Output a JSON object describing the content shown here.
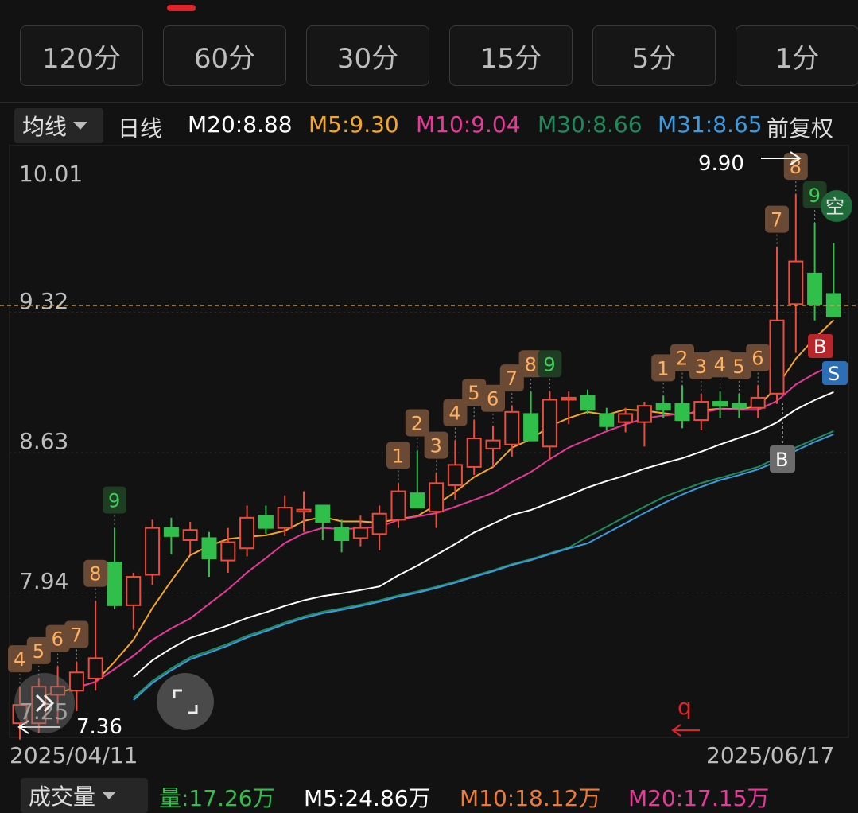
{
  "period_tabs": [
    "120分",
    "60分",
    "30分",
    "15分",
    "5分",
    "1分"
  ],
  "ma_selector": "均线",
  "kline_type": "日线",
  "ma_values": [
    {
      "label": "M20:8.88",
      "color": "#ffffff"
    },
    {
      "label": "M5:9.30",
      "color": "#f5a623"
    },
    {
      "label": "M10:9.04",
      "color": "#e8399a"
    },
    {
      "label": "M30:8.66",
      "color": "#1f8a5b"
    },
    {
      "label": "M31:8.65",
      "color": "#3b9be0"
    }
  ],
  "adjust": "前复权",
  "price_axis": [
    "10.01",
    "9.32",
    "8.63",
    "7.94",
    "7.25"
  ],
  "high_label": "9.90",
  "low_label": "7.36",
  "date_start": "2025/04/11",
  "date_end": "2025/06/17",
  "volume_selector": "成交量",
  "volume_values": [
    {
      "label": "量:17.26万",
      "color": "#2fbf4a"
    },
    {
      "label": "M5:24.86万",
      "color": "#ffffff"
    },
    {
      "label": "M10:18.12万",
      "color": "#f07a30"
    },
    {
      "label": "M20:17.15万",
      "color": "#e8399a"
    }
  ],
  "signal_labels": [
    "B",
    "S",
    "B",
    "空",
    "q"
  ],
  "colors": {
    "up": "#f04a3a",
    "down": "#2fbf4a",
    "grid": "#2a2a2a"
  },
  "chart_data": {
    "type": "candlestick",
    "ylim": [
      7.25,
      10.01
    ],
    "candles": [
      {
        "o": 7.3,
        "h": 7.48,
        "l": 7.22,
        "c": 7.39,
        "n": "4"
      },
      {
        "o": 7.3,
        "h": 7.52,
        "l": 7.25,
        "c": 7.48,
        "n": "5"
      },
      {
        "o": 7.44,
        "h": 7.58,
        "l": 7.3,
        "c": 7.48,
        "n": "6"
      },
      {
        "o": 7.46,
        "h": 7.6,
        "l": 7.36,
        "c": 7.55,
        "n": "7"
      },
      {
        "o": 7.52,
        "h": 7.9,
        "l": 7.46,
        "c": 7.62,
        "n": "8"
      },
      {
        "o": 8.09,
        "h": 8.26,
        "l": 7.86,
        "c": 7.88,
        "n": "9"
      },
      {
        "o": 7.88,
        "h": 8.04,
        "l": 7.76,
        "c": 8.02,
        "n": ""
      },
      {
        "o": 8.03,
        "h": 8.3,
        "l": 7.98,
        "c": 8.26,
        "n": ""
      },
      {
        "o": 8.26,
        "h": 8.31,
        "l": 8.13,
        "c": 8.22,
        "n": ""
      },
      {
        "o": 8.2,
        "h": 8.29,
        "l": 8.13,
        "c": 8.25,
        "n": ""
      },
      {
        "o": 8.21,
        "h": 8.24,
        "l": 8.02,
        "c": 8.11,
        "n": ""
      },
      {
        "o": 8.1,
        "h": 8.26,
        "l": 8.04,
        "c": 8.19,
        "n": ""
      },
      {
        "o": 8.16,
        "h": 8.37,
        "l": 8.12,
        "c": 8.31,
        "n": ""
      },
      {
        "o": 8.32,
        "h": 8.37,
        "l": 8.23,
        "c": 8.26,
        "n": ""
      },
      {
        "o": 8.26,
        "h": 8.42,
        "l": 8.22,
        "c": 8.36,
        "n": ""
      },
      {
        "o": 8.34,
        "h": 8.44,
        "l": 8.24,
        "c": 8.35,
        "n": ""
      },
      {
        "o": 8.37,
        "h": 8.37,
        "l": 8.2,
        "c": 8.29,
        "n": ""
      },
      {
        "o": 8.26,
        "h": 8.3,
        "l": 8.14,
        "c": 8.2,
        "n": ""
      },
      {
        "o": 8.21,
        "h": 8.32,
        "l": 8.17,
        "c": 8.26,
        "n": ""
      },
      {
        "o": 8.23,
        "h": 8.37,
        "l": 8.15,
        "c": 8.33,
        "n": ""
      },
      {
        "o": 8.3,
        "h": 8.48,
        "l": 8.26,
        "c": 8.44,
        "n": "1"
      },
      {
        "o": 8.43,
        "h": 8.64,
        "l": 8.36,
        "c": 8.36,
        "n": "2"
      },
      {
        "o": 8.34,
        "h": 8.53,
        "l": 8.26,
        "c": 8.48,
        "n": "3"
      },
      {
        "o": 8.47,
        "h": 8.69,
        "l": 8.4,
        "c": 8.57,
        "n": "4"
      },
      {
        "o": 8.56,
        "h": 8.79,
        "l": 8.52,
        "c": 8.7,
        "n": "5"
      },
      {
        "o": 8.65,
        "h": 8.76,
        "l": 8.56,
        "c": 8.69,
        "n": "6"
      },
      {
        "o": 8.67,
        "h": 8.86,
        "l": 8.61,
        "c": 8.83,
        "n": "7"
      },
      {
        "o": 8.82,
        "h": 8.93,
        "l": 8.7,
        "c": 8.69,
        "n": "8"
      },
      {
        "o": 8.66,
        "h": 8.93,
        "l": 8.6,
        "c": 8.89,
        "n": "9"
      },
      {
        "o": 8.89,
        "h": 8.93,
        "l": 8.77,
        "c": 8.9,
        "n": ""
      },
      {
        "o": 8.91,
        "h": 8.94,
        "l": 8.82,
        "c": 8.84,
        "n": ""
      },
      {
        "o": 8.82,
        "h": 8.85,
        "l": 8.74,
        "c": 8.76,
        "n": ""
      },
      {
        "o": 8.78,
        "h": 8.85,
        "l": 8.73,
        "c": 8.82,
        "n": ""
      },
      {
        "o": 8.78,
        "h": 8.88,
        "l": 8.66,
        "c": 8.86,
        "n": ""
      },
      {
        "o": 8.87,
        "h": 8.91,
        "l": 8.8,
        "c": 8.84,
        "n": "1"
      },
      {
        "o": 8.87,
        "h": 8.96,
        "l": 8.75,
        "c": 8.79,
        "n": "2"
      },
      {
        "o": 8.79,
        "h": 8.92,
        "l": 8.74,
        "c": 8.88,
        "n": "3"
      },
      {
        "o": 8.88,
        "h": 8.93,
        "l": 8.8,
        "c": 8.86,
        "n": "4"
      },
      {
        "o": 8.87,
        "h": 8.92,
        "l": 8.8,
        "c": 8.85,
        "n": "5"
      },
      {
        "o": 8.85,
        "h": 8.96,
        "l": 8.8,
        "c": 8.9,
        "n": "6"
      },
      {
        "o": 8.92,
        "h": 9.64,
        "l": 8.87,
        "c": 9.28,
        "n": "7"
      },
      {
        "o": 9.36,
        "h": 9.9,
        "l": 9.12,
        "c": 9.57,
        "n": "8"
      },
      {
        "o": 9.51,
        "h": 9.76,
        "l": 9.28,
        "c": 9.36,
        "n": "9"
      },
      {
        "o": 9.41,
        "h": 9.66,
        "l": 9.33,
        "c": 9.3,
        "n": "空"
      }
    ]
  }
}
